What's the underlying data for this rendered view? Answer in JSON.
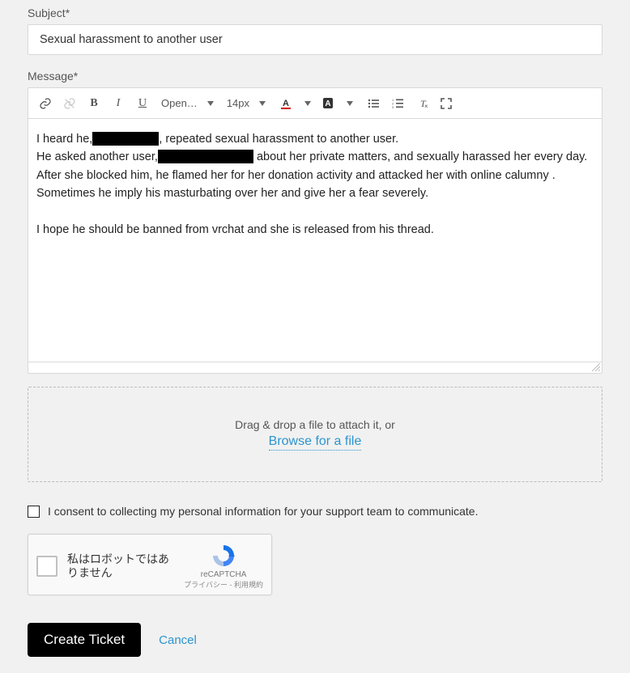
{
  "subject": {
    "label": "Subject*",
    "value": "Sexual harassment to another user"
  },
  "message": {
    "label": "Message*",
    "font_family": "Open…",
    "font_size": "14px",
    "body": {
      "line1a": "I heard he,",
      "line1b": ", repeated sexual harassment to another user.",
      "line2a": "He asked another user,",
      "line2b": " about her private matters, and sexually harassed her every day.",
      "line3": "After she blocked him, he flamed her for her donation activity and attacked her with online calumny .",
      "line4": "Sometimes he imply his masturbating over her and give her a fear severely.",
      "line5": "I hope he should be banned from vrchat and she is released from his thread."
    }
  },
  "dropzone": {
    "text": "Drag & drop a file to attach it, or",
    "browse": "Browse for a file"
  },
  "consent": {
    "label": "I consent to collecting my personal information for your support team to communicate.",
    "checked": false
  },
  "recaptcha": {
    "label": "私はロボットではありません",
    "brand": "reCAPTCHA",
    "legal": "プライバシー - 利用規約"
  },
  "actions": {
    "submit": "Create Ticket",
    "cancel": "Cancel"
  },
  "colors": {
    "link": "#2c95cf",
    "primary_bg": "#000000",
    "primary_fg": "#ffffff"
  }
}
